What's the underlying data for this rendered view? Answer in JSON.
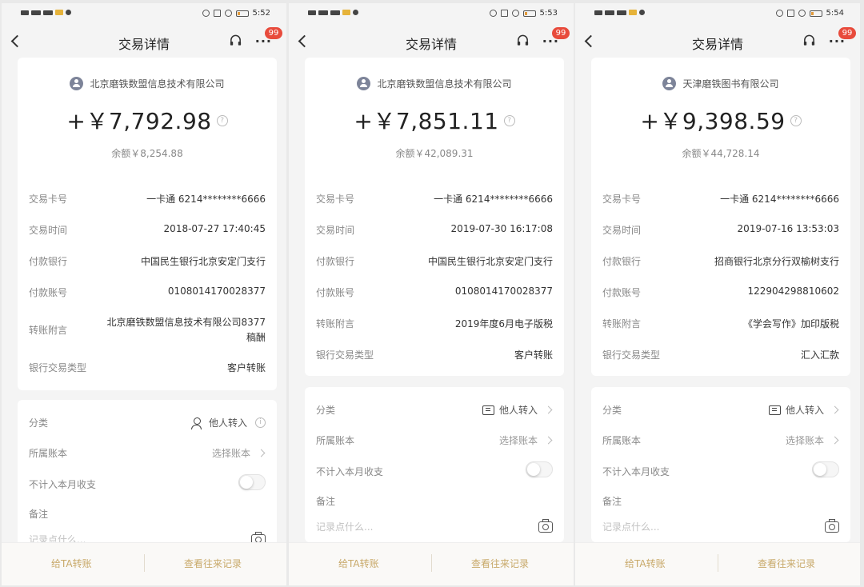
{
  "screens": [
    {
      "status_time": "5:52",
      "nav_title": "交易详情",
      "badge": "99",
      "company": "北京磨铁数盟信息技术有限公司",
      "amount": "+￥7,792.98",
      "balance": "余额￥8,254.88",
      "details": [
        {
          "label": "交易卡号",
          "value": "一卡通 6214********6666"
        },
        {
          "label": "交易时间",
          "value": "2018-07-27 17:40:45"
        },
        {
          "label": "付款银行",
          "value": "中国民生银行北京安定门支行"
        },
        {
          "label": "付款账号",
          "value": "0108014170028377"
        },
        {
          "label": "转账附言",
          "value": "北京磨铁数盟信息技术有限公司8377稿酬"
        },
        {
          "label": "银行交易类型",
          "value": "客户转账"
        }
      ],
      "category_label": "分类",
      "category_value": "他人转入",
      "account_label": "所属账本",
      "account_value": "选择账本",
      "exclude_label": "不计入本月收支",
      "note_label": "备注",
      "note_placeholder": "记录点什么...",
      "transfer_button": "给TA转账",
      "history_button": "查看往来记录"
    },
    {
      "status_time": "5:53",
      "nav_title": "交易详情",
      "badge": "99",
      "company": "北京磨铁数盟信息技术有限公司",
      "amount": "+￥7,851.11",
      "balance": "余额￥42,089.31",
      "details": [
        {
          "label": "交易卡号",
          "value": "一卡通 6214********6666"
        },
        {
          "label": "交易时间",
          "value": "2019-07-30 16:17:08"
        },
        {
          "label": "付款银行",
          "value": "中国民生银行北京安定门支行"
        },
        {
          "label": "付款账号",
          "value": "0108014170028377"
        },
        {
          "label": "转账附言",
          "value": "2019年度6月电子版税"
        },
        {
          "label": "银行交易类型",
          "value": "客户转账"
        }
      ],
      "category_label": "分类",
      "category_value": "他人转入",
      "account_label": "所属账本",
      "account_value": "选择账本",
      "exclude_label": "不计入本月收支",
      "note_label": "备注",
      "note_placeholder": "记录点什么...",
      "transfer_button": "给TA转账",
      "history_button": "查看往来记录"
    },
    {
      "status_time": "5:54",
      "nav_title": "交易详情",
      "badge": "99",
      "company": "天津磨铁图书有限公司",
      "amount": "+￥9,398.59",
      "balance": "余额￥44,728.14",
      "details": [
        {
          "label": "交易卡号",
          "value": "一卡通 6214********6666"
        },
        {
          "label": "交易时间",
          "value": "2019-07-16 13:53:03"
        },
        {
          "label": "付款银行",
          "value": "招商银行北京分行双榆树支行"
        },
        {
          "label": "付款账号",
          "value": "122904298810602"
        },
        {
          "label": "转账附言",
          "value": "《学会写作》加印版税"
        },
        {
          "label": "银行交易类型",
          "value": "汇入汇款"
        }
      ],
      "category_label": "分类",
      "category_value": "他人转入",
      "account_label": "所属账本",
      "account_value": "选择账本",
      "exclude_label": "不计入本月收支",
      "note_label": "备注",
      "note_placeholder": "记录点什么...",
      "transfer_button": "给TA转账",
      "history_button": "查看往来记录"
    }
  ]
}
